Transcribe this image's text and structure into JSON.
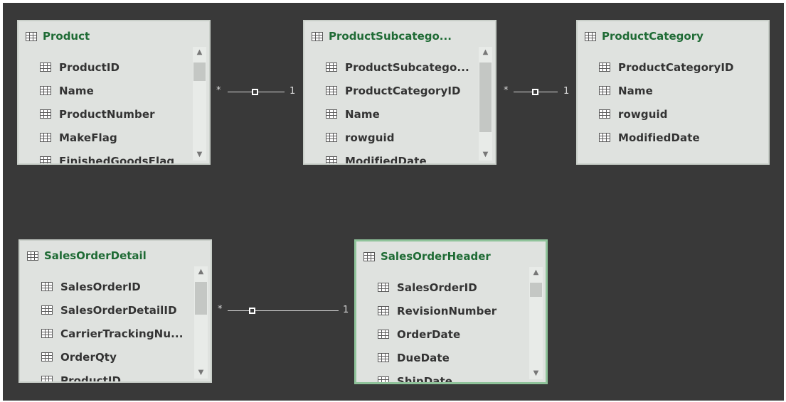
{
  "tables": {
    "product": {
      "title": "Product",
      "fields": [
        "ProductID",
        "Name",
        "ProductNumber",
        "MakeFlag",
        "FinishedGoodsFlag"
      ]
    },
    "product_subcategory": {
      "title": "ProductSubcatego...",
      "fields": [
        "ProductSubcatego...",
        "ProductCategoryID",
        "Name",
        "rowguid",
        "ModifiedDate"
      ]
    },
    "product_category": {
      "title": "ProductCategory",
      "fields": [
        "ProductCategoryID",
        "Name",
        "rowguid",
        "ModifiedDate"
      ]
    },
    "sales_order_detail": {
      "title": "SalesOrderDetail",
      "fields": [
        "SalesOrderID",
        "SalesOrderDetailID",
        "CarrierTrackingNu...",
        "OrderQty",
        "ProductID"
      ]
    },
    "sales_order_header": {
      "title": "SalesOrderHeader",
      "fields": [
        "SalesOrderID",
        "RevisionNumber",
        "OrderDate",
        "DueDate",
        "ShipDate"
      ]
    }
  },
  "relationships": [
    {
      "from": "Product",
      "to": "ProductSubcatego...",
      "many": "*",
      "one": "1"
    },
    {
      "from": "ProductSubcatego...",
      "to": "ProductCategory",
      "many": "*",
      "one": "1"
    },
    {
      "from": "SalesOrderDetail",
      "to": "SalesOrderHeader",
      "many": "*",
      "one": "1"
    }
  ],
  "colors": {
    "canvas": "#393939",
    "card": "#dfe2df",
    "title": "#1f6b35",
    "selected_border": "#8fc39a"
  },
  "icons": {
    "table": "table-icon",
    "field": "column-icon",
    "scroll_up": "chevron-up-icon",
    "scroll_down": "chevron-down-icon"
  }
}
